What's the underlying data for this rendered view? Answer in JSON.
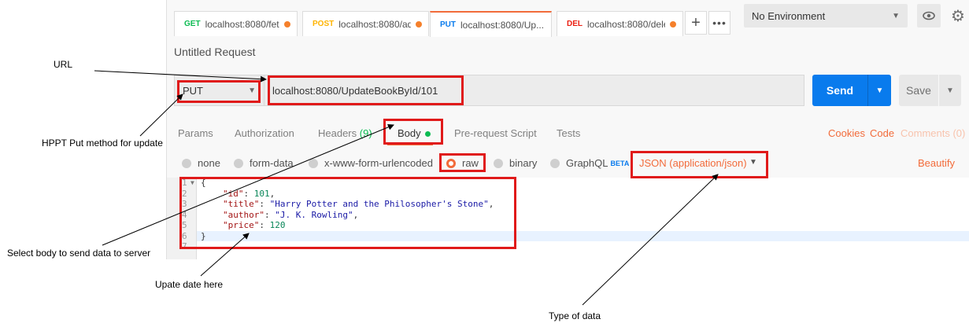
{
  "tabs": [
    {
      "method": "GET",
      "url": "localhost:8080/fetc..."
    },
    {
      "method": "POST",
      "url": "localhost:8080/ad..."
    },
    {
      "method": "PUT",
      "url": "localhost:8080/Up..."
    },
    {
      "method": "DEL",
      "url": "localhost:8080/dele..."
    }
  ],
  "tab_add": "+",
  "tab_more": "•••",
  "environment": {
    "selected": "No Environment"
  },
  "request_title": "Untitled Request",
  "request": {
    "method": "PUT",
    "url": "localhost:8080/UpdateBookById/101",
    "send_label": "Send",
    "save_label": "Save"
  },
  "request_tabs": {
    "params": "Params",
    "authorization": "Authorization",
    "headers": "Headers",
    "headers_count": "(9)",
    "body": "Body",
    "prerequest": "Pre-request Script",
    "tests": "Tests"
  },
  "links": {
    "cookies": "Cookies",
    "code": "Code",
    "comments": "Comments (0)"
  },
  "body_types": {
    "none": "none",
    "form_data": "form-data",
    "urlencoded": "x-www-form-urlencoded",
    "raw": "raw",
    "binary": "binary",
    "graphql": "GraphQL",
    "graphql_badge": "BETA",
    "selected": "raw"
  },
  "content_type": "JSON (application/json)",
  "beautify": "Beautify",
  "editor": {
    "line_numbers": [
      "1",
      "2",
      "3",
      "4",
      "5",
      "6",
      "7"
    ],
    "open_brace": "{",
    "close_brace": "}",
    "fields": [
      {
        "key": "\"id\"",
        "value": "101",
        "kind": "num"
      },
      {
        "key": "\"title\"",
        "value": "\"Harry Potter and the Philosopher's Stone\"",
        "kind": "str"
      },
      {
        "key": "\"author\"",
        "value": "\"J. K. Rowling\"",
        "kind": "str"
      },
      {
        "key": "\"price\"",
        "value": "120",
        "kind": "num"
      }
    ]
  },
  "annotations": {
    "url": "URL",
    "method": "HPPT Put method for update",
    "body": "Select body to send data to server",
    "update": "Upate date here",
    "type": "Type of data"
  },
  "colors": {
    "accent": "#f26b3a",
    "send": "#097bed",
    "annotation_box": "#e01a1a",
    "get": "#0cbb52",
    "post": "#ffb400",
    "put": "#097bed",
    "del": "#eb2013"
  }
}
